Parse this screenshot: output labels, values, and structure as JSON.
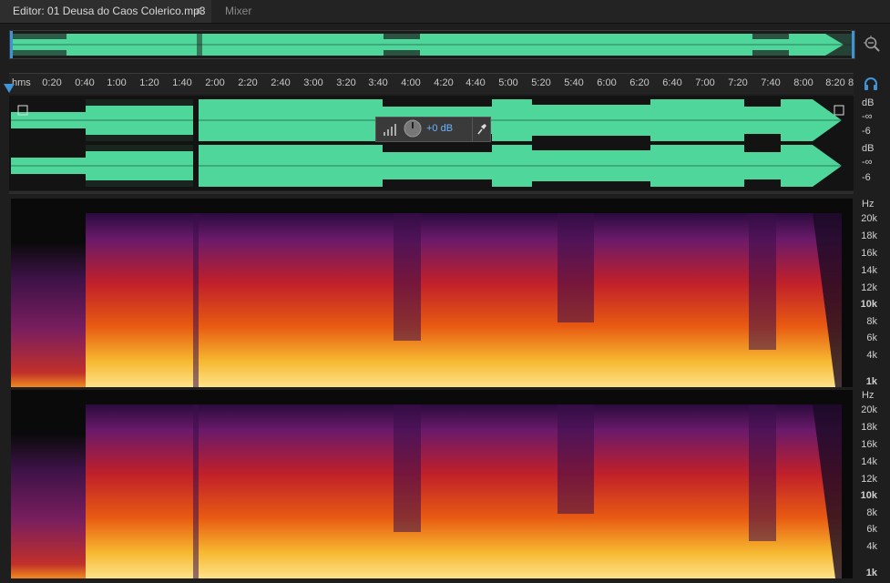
{
  "tabs": {
    "editor_label": "Editor: 01 Deusa do Caos Colerico.mp3",
    "menu_glyph": "≡",
    "mixer_label": "Mixer"
  },
  "icons": {
    "zoom": "zoom-icon",
    "headset": "headset-icon",
    "pin": "pin-icon",
    "knob": "volume-knob-icon",
    "level": "level-bars-icon"
  },
  "ruler": {
    "unit_label": "hms",
    "ticks": [
      "0:20",
      "0:40",
      "1:00",
      "1:20",
      "1:40",
      "2:00",
      "2:20",
      "2:40",
      "3:00",
      "3:20",
      "3:40",
      "4:00",
      "4:20",
      "4:40",
      "5:00",
      "5:20",
      "5:40",
      "6:00",
      "6:20",
      "6:40",
      "7:00",
      "7:20",
      "7:40",
      "8:00",
      "8:20",
      "8"
    ]
  },
  "hud": {
    "gain_label": "+0 dB"
  },
  "db_scale": {
    "unit": "dB",
    "inf_top": "-∞",
    "six": "-6",
    "inf_bottom": "-∞"
  },
  "hz_scale": {
    "unit": "Hz",
    "labels": [
      "20k",
      "18k",
      "16k",
      "14k",
      "12k",
      "10k",
      "8k",
      "6k",
      "4k",
      "1k"
    ]
  },
  "colors": {
    "waveform": "#4fd69b",
    "playhead": "#3f94d8",
    "hud_text": "#6ab3ff",
    "accent": "#3f94d8"
  }
}
